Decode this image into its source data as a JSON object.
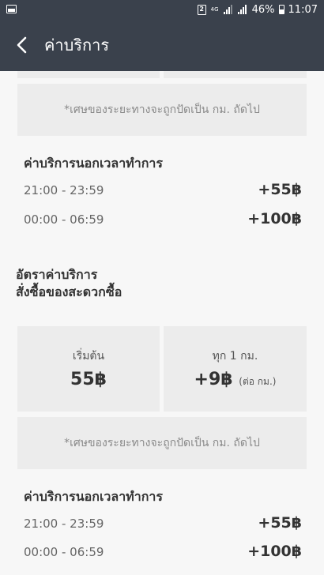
{
  "status_bar": {
    "sim_label": "2",
    "network_label": "4G",
    "battery_percent": "46%",
    "time": "11:07"
  },
  "header": {
    "title": "ค่าบริการ"
  },
  "notes": {
    "rounding": "*เศษของระยะทางจะถูกปัดเป็น กม. ถัดไป"
  },
  "section1": {
    "title": "ค่าบริการนอกเวลาทำการ",
    "rows": [
      {
        "time": "21:00 - 23:59",
        "price": "+55฿"
      },
      {
        "time": "00:00 - 06:59",
        "price": "+100฿"
      }
    ]
  },
  "convenience_rate": {
    "title_line1": "อัตราค่าบริการ",
    "title_line2": "สั่งซื้อของสะดวกซื้อ",
    "start_label": "เริ่มต้น",
    "start_value": "55฿",
    "per_km_label": "ทุก 1 กม.",
    "per_km_value": "+9฿",
    "per_km_unit": "(ต่อ กม.)"
  },
  "section2": {
    "title": "ค่าบริการนอกเวลาทำการ",
    "rows": [
      {
        "time": "21:00 - 23:59",
        "price": "+55฿"
      },
      {
        "time": "00:00 - 06:59",
        "price": "+100฿"
      }
    ]
  }
}
